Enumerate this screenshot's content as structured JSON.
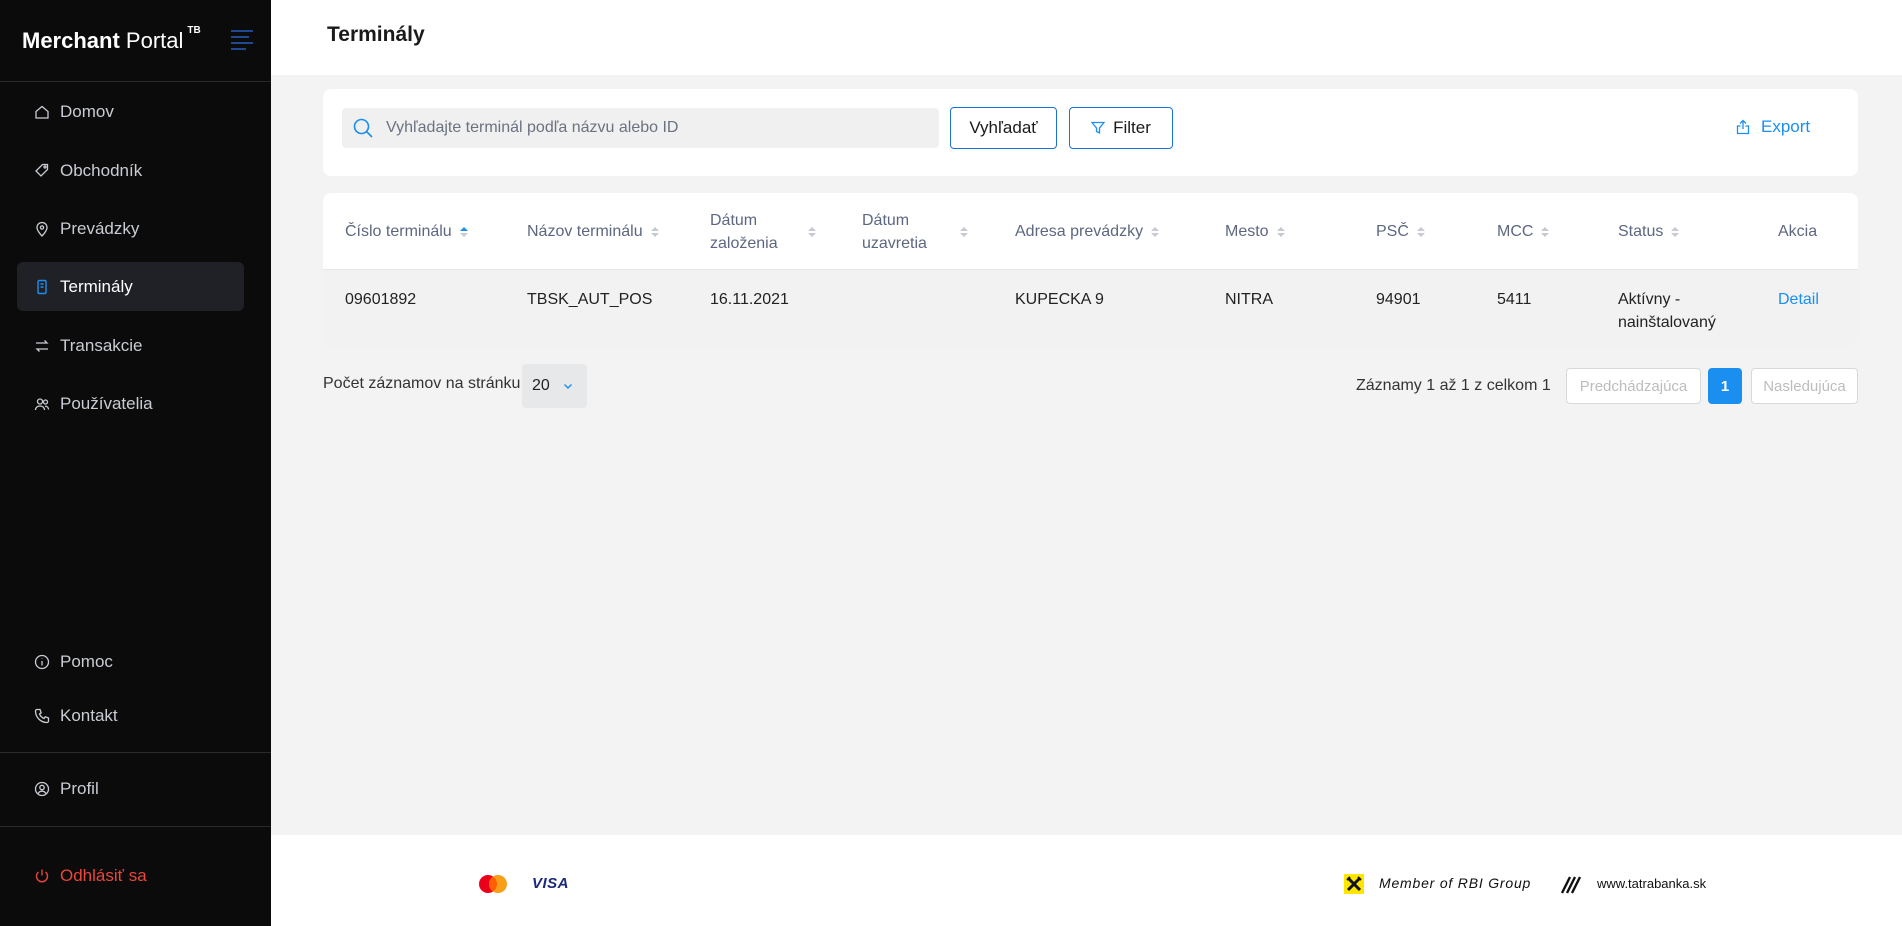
{
  "brand": {
    "title_bold": "Merchant",
    "title_rest": "Portal",
    "sup": "TB"
  },
  "sidebar": {
    "items": [
      {
        "label": "Domov",
        "icon": "home-icon"
      },
      {
        "label": "Obchodník",
        "icon": "tag-icon"
      },
      {
        "label": "Prevádzky",
        "icon": "location-pin-icon"
      },
      {
        "label": "Terminály",
        "icon": "phone-terminal-icon",
        "active": true
      },
      {
        "label": "Transakcie",
        "icon": "transfer-arrows-icon"
      },
      {
        "label": "Používatelia",
        "icon": "users-icon"
      }
    ],
    "bottom": [
      {
        "label": "Pomoc",
        "icon": "info-icon"
      },
      {
        "label": "Kontakt",
        "icon": "phone-icon"
      }
    ],
    "profile": {
      "label": "Profil",
      "icon": "user-circle-icon"
    },
    "logout": {
      "label": "Odhlásiť sa",
      "icon": "power-icon",
      "color": "#e8473d"
    }
  },
  "header": {
    "title": "Terminály"
  },
  "search": {
    "placeholder": "Vyhľadajte terminál podľa názvu alebo ID",
    "value": "",
    "search_button": "Vyhľadať",
    "filter_button": "Filter",
    "export_button": "Export"
  },
  "table": {
    "columns": [
      {
        "line1": "Číslo terminálu",
        "line2": "",
        "sort": "asc"
      },
      {
        "line1": "Názov terminálu",
        "line2": "",
        "sort": "none"
      },
      {
        "line1": "Dátum",
        "line2": "založenia",
        "sort": "none"
      },
      {
        "line1": "Dátum",
        "line2": "uzavretia",
        "sort": "none"
      },
      {
        "line1": "Adresa prevádzky",
        "line2": "",
        "sort": "none"
      },
      {
        "line1": "Mesto",
        "line2": "",
        "sort": "none"
      },
      {
        "line1": "PSČ",
        "line2": "",
        "sort": "none"
      },
      {
        "line1": "MCC",
        "line2": "",
        "sort": "none"
      },
      {
        "line1": "Status",
        "line2": "",
        "sort": "none"
      },
      {
        "line1": "Akcia",
        "line2": ""
      }
    ],
    "rows": [
      {
        "cislo": "09601892",
        "nazov": "TBSK_AUT_POS",
        "zalozenia": "16.11.2021",
        "uzavretia": "",
        "adresa": "KUPECKA 9",
        "mesto": "NITRA",
        "psc": "94901",
        "mcc": "5411",
        "status_line1": "Aktívny -",
        "status_line2": "nainštalovaný",
        "akcia": "Detail"
      }
    ]
  },
  "pagination": {
    "page_size_label": "Počet záznamov na stránku",
    "page_size": "20",
    "records_info": "Záznamy 1 až 1 z celkom 1",
    "prev": "Predchádzajúca",
    "current": "1",
    "next": "Nasledujúca"
  },
  "footer": {
    "visa": "VISA",
    "rbi": "Member of RBI Group",
    "website": "www.tatrabanka.sk"
  },
  "colors": {
    "accent": "#1a8ff0",
    "sidebar_bg": "#0b0b0b",
    "logout": "#e8473d",
    "content_bg": "#f3f3f3"
  }
}
